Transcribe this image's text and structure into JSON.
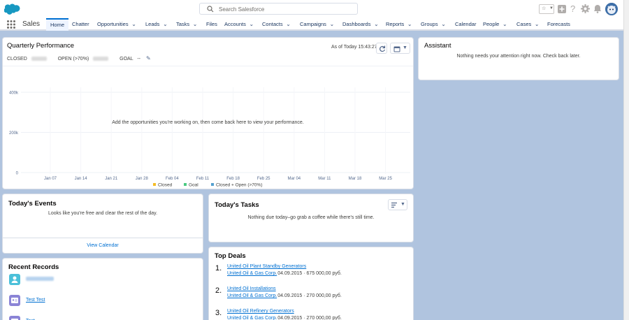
{
  "header": {
    "search_placeholder": "Search Salesforce",
    "brand_color": "#1798c1"
  },
  "nav": {
    "app_name": "Sales",
    "tabs": [
      {
        "label": "Home",
        "chevron": false,
        "active": true
      },
      {
        "label": "Chatter",
        "chevron": false
      },
      {
        "label": "Opportunities",
        "chevron": true
      },
      {
        "label": "Leads",
        "chevron": true
      },
      {
        "label": "Tasks",
        "chevron": true
      },
      {
        "label": "Files",
        "chevron": false
      },
      {
        "label": "Accounts",
        "chevron": true
      },
      {
        "label": "Contacts",
        "chevron": true
      },
      {
        "label": "Campaigns",
        "chevron": true
      },
      {
        "label": "Dashboards",
        "chevron": true
      },
      {
        "label": "Reports",
        "chevron": true
      },
      {
        "label": "Groups",
        "chevron": true
      },
      {
        "label": "Calendar",
        "chevron": false
      },
      {
        "label": "People",
        "chevron": true
      },
      {
        "label": "Cases",
        "chevron": true
      },
      {
        "label": "Forecasts",
        "chevron": false
      }
    ]
  },
  "performance": {
    "title": "Quarterly Performance",
    "as_of": "As of Today 15:43:27",
    "closed_label": "CLOSED",
    "open_label": "OPEN (>70%)",
    "goal_label": "GOAL",
    "goal_value": "--",
    "empty_message": "Add the opportunities you're working on, then come back here to view your performance."
  },
  "chart_data": {
    "type": "line",
    "x": [
      "Jan 07",
      "Jan 14",
      "Jan 21",
      "Jan 28",
      "Feb 04",
      "Feb 11",
      "Feb 18",
      "Feb 25",
      "Mar 04",
      "Mar 11",
      "Mar 18",
      "Mar 25"
    ],
    "yticks": [
      "0",
      "200k",
      "400k"
    ],
    "ylim": [
      0,
      400000
    ],
    "series": [
      {
        "name": "Closed",
        "color": "#f4bc25",
        "values": []
      },
      {
        "name": "Goal",
        "color": "#4bca81",
        "values": []
      },
      {
        "name": "Closed + Open (>70%)",
        "color": "#54a0cf",
        "values": []
      }
    ],
    "legend": "bottom",
    "grid": true
  },
  "assistant": {
    "title": "Assistant",
    "message": "Nothing needs your attention right now. Check back later."
  },
  "events": {
    "title": "Today's Events",
    "message": "Looks like you're free and clear the rest of the day.",
    "view_calendar": "View Calendar"
  },
  "tasks": {
    "title": "Today's Tasks",
    "message": "Nothing due today–go grab a coffee while there's still time."
  },
  "recent": {
    "title": "Recent Records",
    "items": [
      {
        "label": "",
        "blurred": true,
        "icon_color": "#4bc0d9"
      },
      {
        "label": "Test Test",
        "blurred": false,
        "icon_color": "#8b84d6"
      },
      {
        "label": "Test",
        "blurred": false,
        "icon_color": "#8b84d6"
      }
    ]
  },
  "deals": {
    "title": "Top Deals",
    "items": [
      {
        "num": "1.",
        "name": "United Oil Plant Standby Generators",
        "account": "United Oil & Gas Corp.",
        "meta": "· 04.09.2015 · 675 000,00 руб."
      },
      {
        "num": "2.",
        "name": "United Oil Installations",
        "account": "United Oil & Gas Corp.",
        "meta": "· 04.09.2015 · 270 000,00 руб."
      },
      {
        "num": "3.",
        "name": "United Oil Refinery Generators",
        "account": "United Oil & Gas Corp.",
        "meta": "· 04.09.2015 · 270 000,00 руб."
      }
    ]
  }
}
